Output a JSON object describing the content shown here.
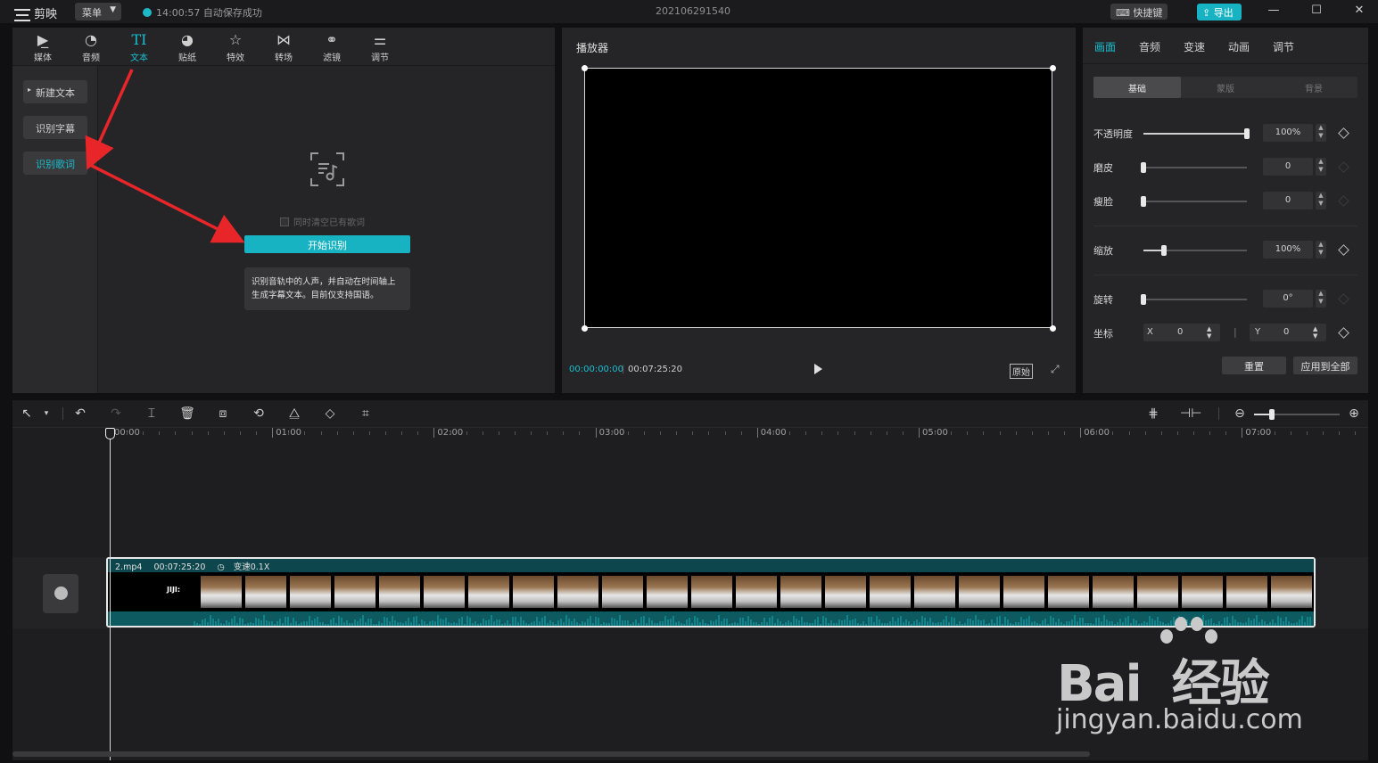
{
  "app": {
    "name": "剪映",
    "menu_label": "菜单",
    "save_status": "14:00:57 自动保存成功",
    "project_title": "202106291540",
    "shortcut_label": "快捷键",
    "export_label": "导出"
  },
  "tool_tabs": [
    {
      "label": "媒体",
      "icon": "media-icon"
    },
    {
      "label": "音频",
      "icon": "audio-icon"
    },
    {
      "label": "文本",
      "icon": "text-icon",
      "glyph": "TI"
    },
    {
      "label": "贴纸",
      "icon": "sticker-icon"
    },
    {
      "label": "特效",
      "icon": "effects-icon"
    },
    {
      "label": "转场",
      "icon": "transition-icon"
    },
    {
      "label": "滤镜",
      "icon": "filter-icon"
    },
    {
      "label": "调节",
      "icon": "adjust-icon"
    }
  ],
  "text_sidebar": {
    "new_text": "新建文本",
    "recognize_subtitles": "识别字幕",
    "recognize_lyrics": "识别歌词"
  },
  "lyrics_panel": {
    "clear_checkbox": "同时清空已有歌词",
    "start_button": "开始识别",
    "hint": "识别音轨中的人声，并自动在时间轴上生成字幕文本。目前仅支持国语。"
  },
  "player": {
    "title": "播放器",
    "current_time": "00:00:00:00",
    "total_time": "00:07:25:20",
    "original_label": "原始"
  },
  "props": {
    "tabs": [
      "画面",
      "音频",
      "变速",
      "动画",
      "调节"
    ],
    "segments": [
      "基础",
      "蒙版",
      "背景"
    ],
    "opacity": {
      "label": "不透明度",
      "value": "100%",
      "fraction": 1.0
    },
    "smooth": {
      "label": "磨皮",
      "value": "0",
      "fraction": 0
    },
    "slim": {
      "label": "瘦脸",
      "value": "0",
      "fraction": 0
    },
    "scale": {
      "label": "缩放",
      "value": "100%",
      "fraction": 0.2
    },
    "rotate": {
      "label": "旋转",
      "value": "0°",
      "fraction": 0
    },
    "position": {
      "label": "坐标",
      "x_label": "X",
      "x_value": "0",
      "y_label": "Y",
      "y_value": "0"
    },
    "reset_label": "重置",
    "apply_all_label": "应用到全部"
  },
  "timeline": {
    "ticks": [
      "00:00",
      "01:00",
      "02:00",
      "03:00",
      "04:00",
      "05:00",
      "06:00",
      "07:00"
    ],
    "clip": {
      "name": "2.mp4",
      "duration": "00:07:25:20",
      "speed": "变速0.1X",
      "first_frame_text": "JIJI:"
    }
  },
  "watermark": {
    "brand": "Bai  经验",
    "url": "jingyan.baidu.com"
  },
  "colors": {
    "accent": "#19bfd0",
    "annotation_arrow": "#e8262a"
  }
}
